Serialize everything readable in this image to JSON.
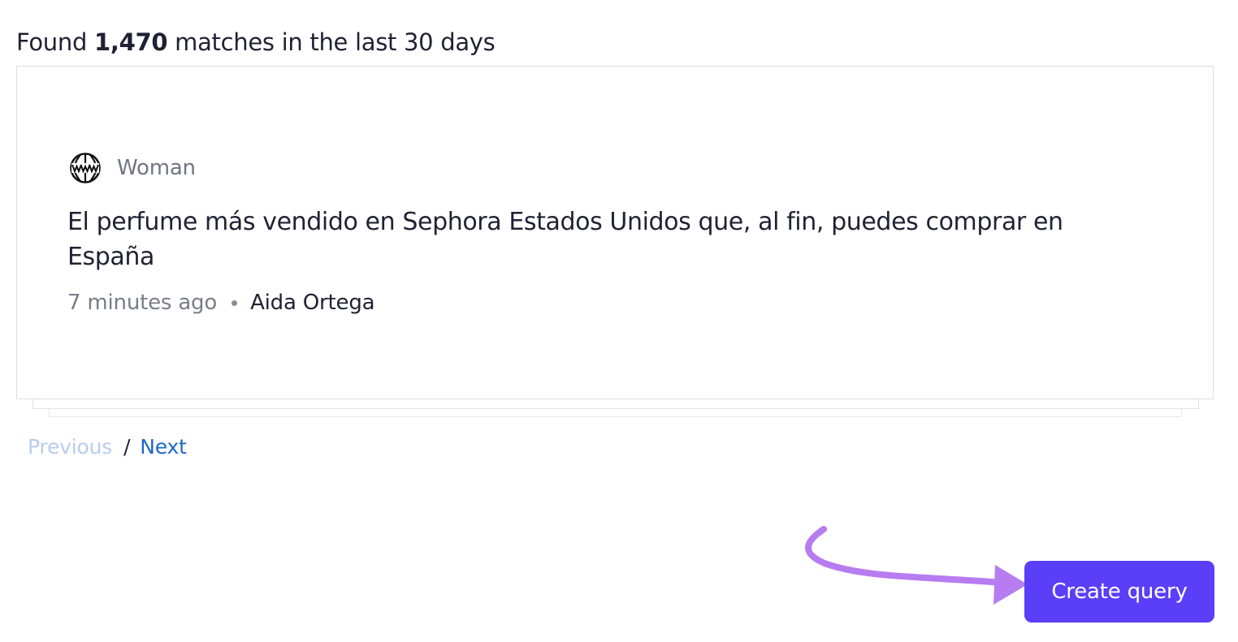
{
  "summary": {
    "prefix": "Found ",
    "count": "1,470",
    "suffix": " matches in the last 30 days"
  },
  "results": [
    {
      "source_icon": "www-globe-icon",
      "source_name": "Woman",
      "headline": "El perfume más vendido en Sephora Estados Unidos que, al fin, puedes comprar en España",
      "time": "7 minutes ago",
      "separator": "•",
      "author": "Aida Ortega"
    }
  ],
  "pagination": {
    "previous_label": "Previous",
    "separator": "/",
    "next_label": "Next",
    "previous_enabled": false
  },
  "actions": {
    "create_query_label": "Create query"
  },
  "colors": {
    "accent": "#5b3ef8",
    "arrow": "#b77cf0",
    "link": "#1f67c7",
    "link_disabled": "#b7cdee",
    "text": "#1f2233",
    "muted": "#727483"
  }
}
